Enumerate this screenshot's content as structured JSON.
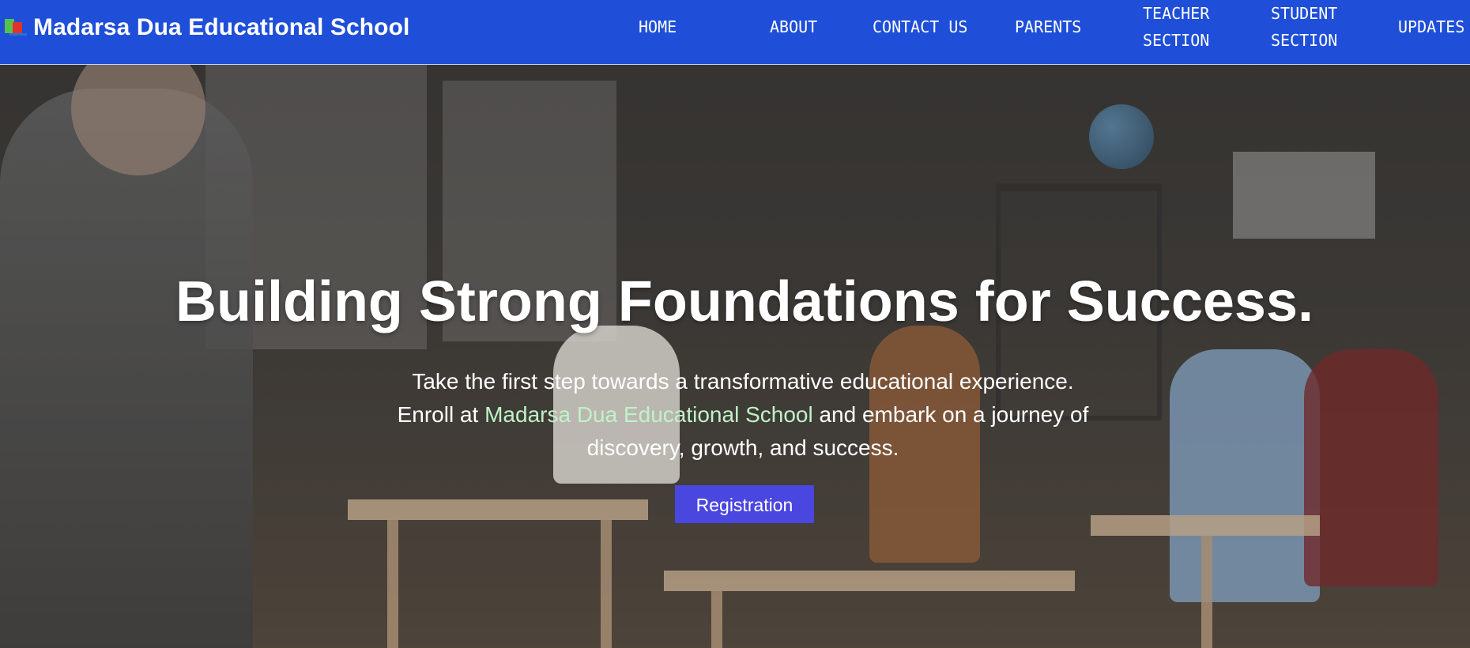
{
  "brand": {
    "title": "Madarsa Dua Educational School",
    "logo_icon": "books-icon"
  },
  "nav": {
    "home": "HOME",
    "about": "ABOUT",
    "contact": "CONTACT US",
    "parents": "PARENTS",
    "teacher_line1": "TEACHER",
    "teacher_line2": "SECTION",
    "student_line1": "STUDENT",
    "student_line2": "SECTION",
    "updates": "UPDATES"
  },
  "hero": {
    "headline": "Building Strong Foundations for Success.",
    "sub_line1": "Take the first step towards a transformative educational experience.",
    "sub_line2_before": "Enroll at ",
    "sub_line2_highlight": "Madarsa Dua Educational School",
    "sub_line2_after": " and embark on a journey of",
    "sub_line3": "discovery, growth, and success.",
    "cta_label": "Registration"
  },
  "colors": {
    "navbar": "#1f4fd8",
    "cta": "#4a46e0",
    "highlight": "#bff2c8"
  }
}
